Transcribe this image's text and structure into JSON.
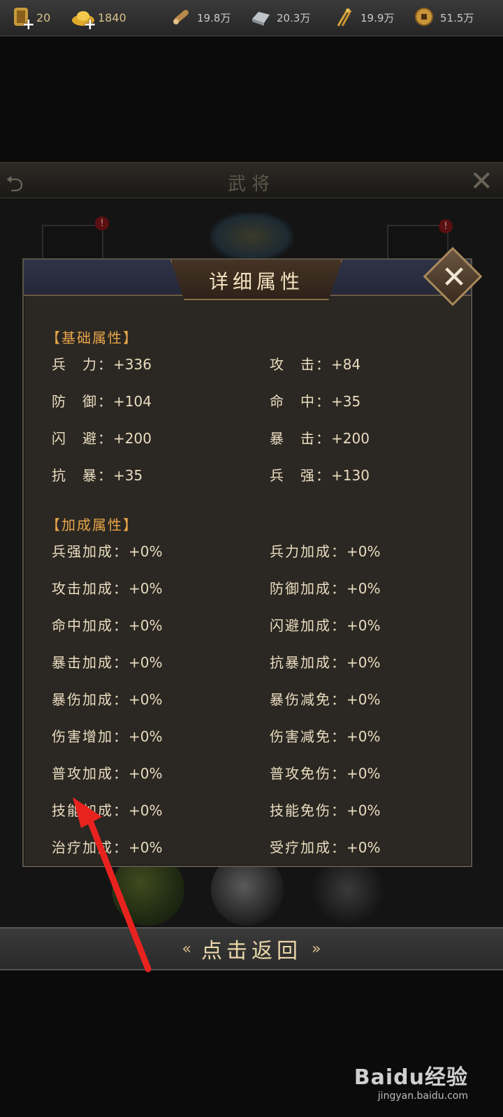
{
  "topbar": {
    "resources": [
      {
        "icon": "stamina-icon",
        "value": "20",
        "has_plus": true
      },
      {
        "icon": "gold-ingot-icon",
        "value": "1840",
        "has_plus": true
      },
      {
        "icon": "wood-icon",
        "value": "19.8万"
      },
      {
        "icon": "iron-icon",
        "value": "20.3万"
      },
      {
        "icon": "grain-icon",
        "value": "19.9万"
      },
      {
        "icon": "coin-icon",
        "value": "51.5万"
      }
    ]
  },
  "background": {
    "title": "武将",
    "badge": "!"
  },
  "modal": {
    "title": "详细属性",
    "basic_section": "【基础属性】",
    "basic": [
      {
        "name": "兵　力：",
        "value": "+336"
      },
      {
        "name": "攻　击：",
        "value": "+84"
      },
      {
        "name": "防　御：",
        "value": "+104"
      },
      {
        "name": "命　中：",
        "value": "+35"
      },
      {
        "name": "闪　避：",
        "value": "+200"
      },
      {
        "name": "暴　击：",
        "value": "+200"
      },
      {
        "name": "抗　暴：",
        "value": "+35"
      },
      {
        "name": "兵　强：",
        "value": "+130"
      }
    ],
    "bonus_section": "【加成属性】",
    "bonus": [
      {
        "name": "兵强加成：",
        "value": "+0%"
      },
      {
        "name": "兵力加成：",
        "value": "+0%"
      },
      {
        "name": "攻击加成：",
        "value": "+0%"
      },
      {
        "name": "防御加成：",
        "value": "+0%"
      },
      {
        "name": "命中加成：",
        "value": "+0%"
      },
      {
        "name": "闪避加成：",
        "value": "+0%"
      },
      {
        "name": "暴击加成：",
        "value": "+0%"
      },
      {
        "name": "抗暴加成：",
        "value": "+0%"
      },
      {
        "name": "暴伤加成：",
        "value": "+0%"
      },
      {
        "name": "暴伤减免：",
        "value": "+0%"
      },
      {
        "name": "伤害增加：",
        "value": "+0%"
      },
      {
        "name": "伤害减免：",
        "value": "+0%"
      },
      {
        "name": "普攻加成：",
        "value": "+0%"
      },
      {
        "name": "普攻免伤：",
        "value": "+0%"
      },
      {
        "name": "技能加成：",
        "value": "+0%"
      },
      {
        "name": "技能免伤：",
        "value": "+0%"
      },
      {
        "name": "治疗加成：",
        "value": "+0%"
      },
      {
        "name": "受疗加成：",
        "value": "+0%"
      }
    ]
  },
  "return_button": {
    "label": "点击返回"
  },
  "watermark": {
    "logo": "Baidu经验",
    "sub": "jingyan.baidu.com"
  },
  "colors": {
    "section": "#e8a64a",
    "text": "#e9dcc0",
    "annotation_arrow": "#e8231f"
  }
}
